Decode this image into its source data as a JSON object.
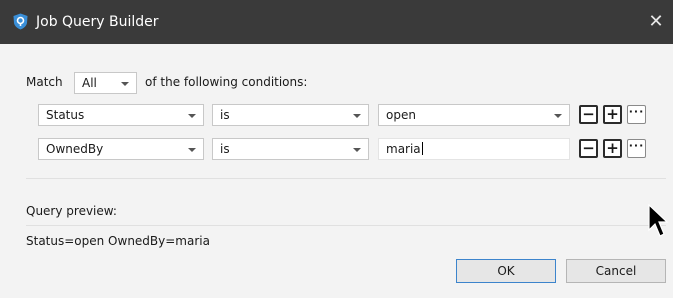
{
  "window": {
    "title": "Job Query Builder",
    "close_label": "✕",
    "accent_color": "#3a8fd8",
    "titlebar_color": "#3a3a3a",
    "icon": "app-shield-icon"
  },
  "match": {
    "label": "Match",
    "selected": "All",
    "suffix": "of the following conditions:"
  },
  "conditions": [
    {
      "field": "Status",
      "operator": "is",
      "value": "open",
      "value_type": "dropdown"
    },
    {
      "field": "OwnedBy",
      "operator": "is",
      "value": "maria",
      "value_type": "text",
      "focused": true
    }
  ],
  "row_buttons": {
    "remove": "−",
    "add": "+",
    "more": "···"
  },
  "preview": {
    "label": "Query preview:",
    "value": "Status=open OwnedBy=maria"
  },
  "buttons": {
    "ok": "OK",
    "cancel": "Cancel"
  },
  "cursor": "arrow-pointer-icon"
}
